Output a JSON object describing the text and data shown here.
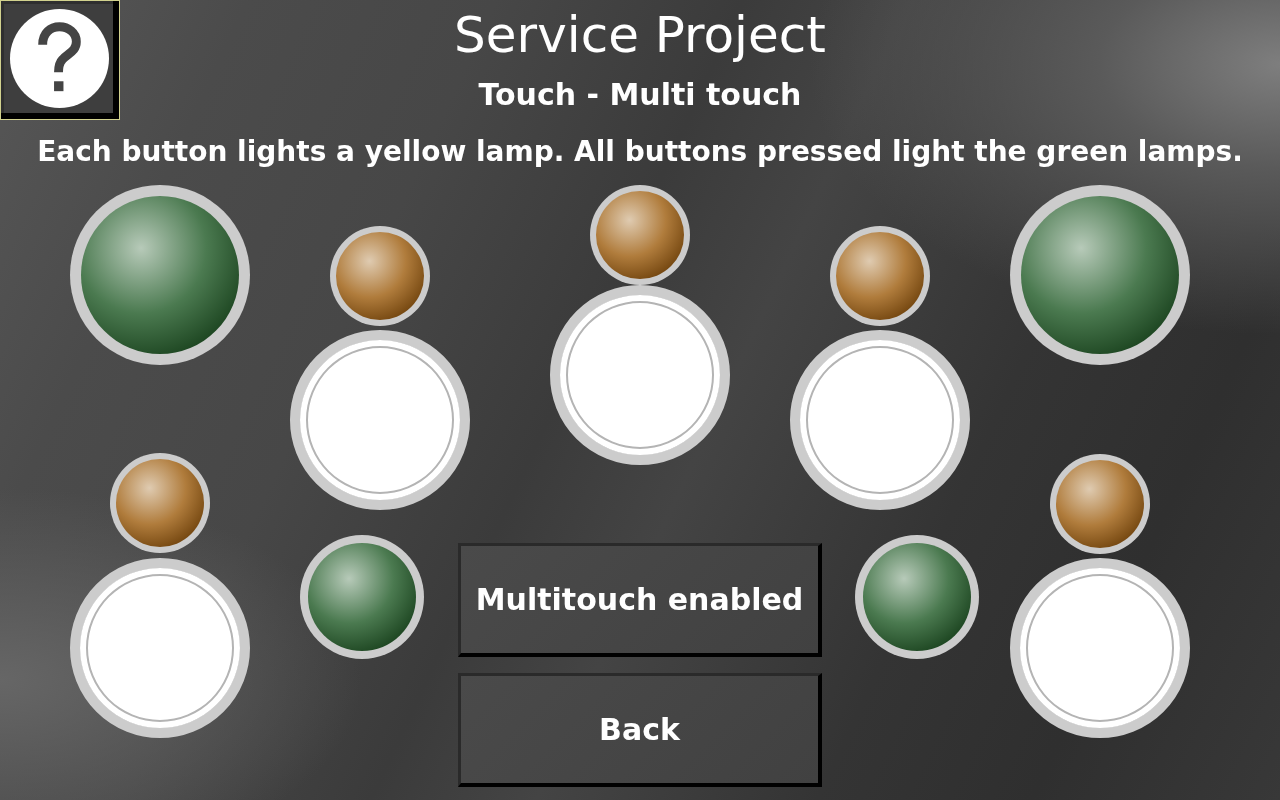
{
  "screen": {
    "title": "Service Project",
    "subtitle": "Touch - Multi touch",
    "instruction": "Each button lights a yellow lamp. All buttons pressed light the green lamps."
  },
  "panel": [
    {
      "kind": "lamp",
      "color": "#4b7a50",
      "lit": false
    },
    {
      "kind": "lamp",
      "color": "#b07c3c",
      "lit": false
    },
    {
      "kind": "lamp",
      "color": "#b07c3c",
      "lit": false
    },
    {
      "kind": "lamp",
      "color": "#b07c3c",
      "lit": false
    },
    {
      "kind": "lamp",
      "color": "#4b7a50",
      "lit": false
    },
    {
      "kind": "touch_button"
    },
    {
      "kind": "touch_button"
    },
    {
      "kind": "touch_button"
    },
    {
      "kind": "lamp",
      "color": "#b07c3c",
      "lit": false
    },
    {
      "kind": "lamp",
      "color": "#b07c3c",
      "lit": false
    },
    {
      "kind": "lamp",
      "color": "#4b7a50",
      "lit": false
    },
    {
      "kind": "lamp",
      "color": "#4b7a50",
      "lit": false
    },
    {
      "kind": "touch_button"
    },
    {
      "kind": "touch_button"
    }
  ],
  "buttons": [
    "Multitouch enabled",
    "Back"
  ]
}
